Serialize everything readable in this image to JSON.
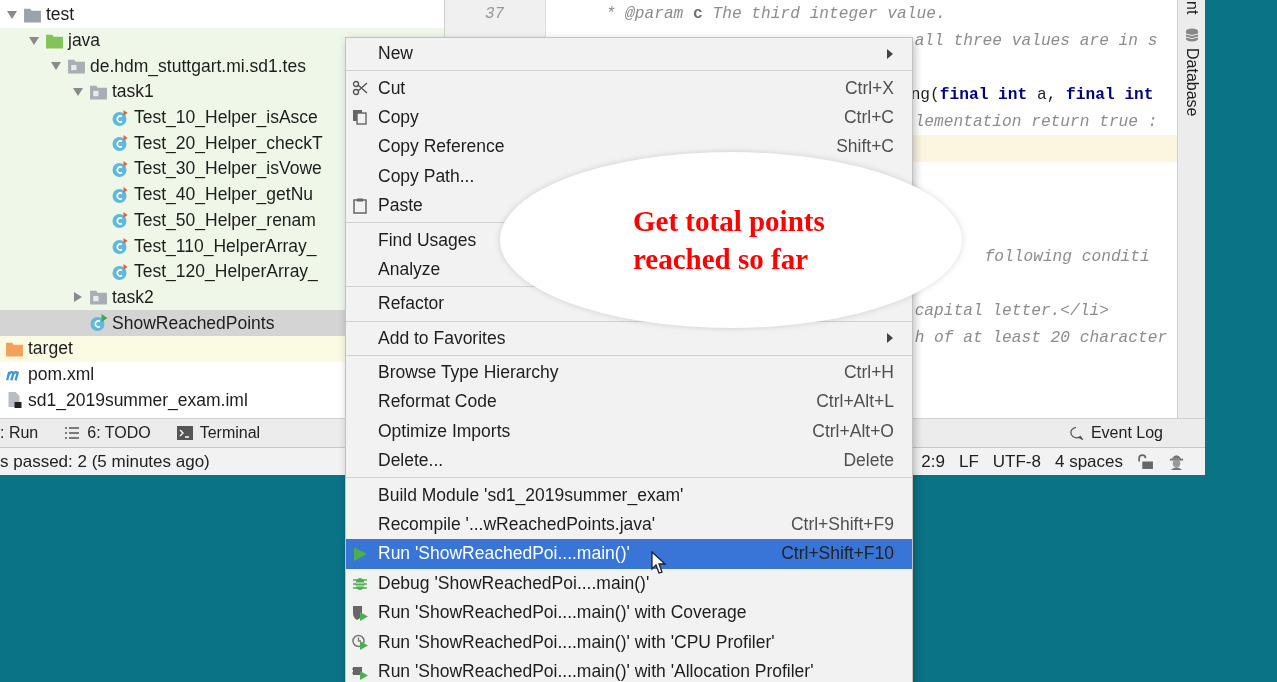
{
  "project_tree": [
    {
      "label": "test",
      "kind": "folder",
      "expanded": true,
      "selected": false,
      "children": [
        {
          "label": "java",
          "kind": "source-folder",
          "expanded": true,
          "selected": false,
          "children": [
            {
              "label": "de.hdm_stuttgart.mi.sd1.tes",
              "kind": "package",
              "expanded": true,
              "selected": false,
              "children": [
                {
                  "label": "task1",
                  "kind": "package",
                  "expanded": true,
                  "selected": false,
                  "children": [
                    {
                      "label": "Test_10_Helper_isAsce",
                      "kind": "test-class",
                      "selected": false
                    },
                    {
                      "label": "Test_20_Helper_checkT",
                      "kind": "test-class",
                      "selected": false
                    },
                    {
                      "label": "Test_30_Helper_isVowe",
                      "kind": "test-class",
                      "selected": false
                    },
                    {
                      "label": "Test_40_Helper_getNu",
                      "kind": "test-class",
                      "selected": false
                    },
                    {
                      "label": "Test_50_Helper_renam",
                      "kind": "test-class",
                      "selected": false
                    },
                    {
                      "label": "Test_110_HelperArray_",
                      "kind": "test-class",
                      "selected": false
                    },
                    {
                      "label": "Test_120_HelperArray_",
                      "kind": "test-class",
                      "selected": false
                    }
                  ]
                },
                {
                  "label": "task2",
                  "kind": "package",
                  "expanded": false,
                  "selected": false
                },
                {
                  "label": "ShowReachedPoints",
                  "kind": "runnable-class",
                  "selected": true
                }
              ]
            }
          ]
        }
      ]
    },
    {
      "label": "target",
      "kind": "excluded-folder",
      "selected": false
    },
    {
      "label": "pom.xml",
      "kind": "maven-file",
      "selected": false
    },
    {
      "label": "sd1_2019summer_exam.iml",
      "kind": "module-file",
      "selected": false
    }
  ],
  "editor": {
    "lines": [
      {
        "kind": "full",
        "number": "37",
        "text": "* @param **c** The third integer value."
      },
      {
        "kind": "tail",
        "text": "all three values are in s"
      },
      {
        "kind": "gap"
      },
      {
        "kind": "tail-code",
        "text": "ng(**final** **int** a, **final** **int**"
      },
      {
        "kind": "tail",
        "text": "lementation return true :"
      },
      {
        "kind": "caret"
      },
      {
        "kind": "gap"
      },
      {
        "kind": "gap"
      },
      {
        "kind": "gap"
      },
      {
        "kind": "deep",
        "text": "following conditi"
      },
      {
        "kind": "gap"
      },
      {
        "kind": "tail",
        "text": "capital letter.</li>"
      },
      {
        "kind": "tail",
        "text": "h of at least 20 character"
      }
    ]
  },
  "side_strip": {
    "tabs": [
      {
        "label": "nt",
        "kind": "ant"
      },
      {
        "label": "Database",
        "kind": "database"
      }
    ]
  },
  "tool_tabs": [
    {
      "label": ": Run",
      "kind": "run"
    },
    {
      "label": "6: TODO",
      "kind": "todo"
    },
    {
      "label": "Terminal",
      "kind": "terminal"
    }
  ],
  "event_log": {
    "label": "Event Log"
  },
  "status_bar": {
    "message": "s passed: 2 (5 minutes ago)",
    "items": [
      "2:9",
      "LF",
      "UTF-8",
      "4 spaces"
    ]
  },
  "context_menu": {
    "items": [
      {
        "kind": "item",
        "label": "New",
        "submenu": true,
        "selected": false
      },
      {
        "kind": "separator"
      },
      {
        "kind": "cut",
        "label": "Cut",
        "shortcut": "Ctrl+X",
        "selected": false
      },
      {
        "kind": "copy",
        "label": "Copy",
        "shortcut": "Ctrl+C",
        "selected": false
      },
      {
        "kind": "item",
        "label": "Copy Reference",
        "shortcut": "Shift+C",
        "selected": false
      },
      {
        "kind": "item",
        "label": "Copy Path...",
        "selected": false
      },
      {
        "kind": "paste",
        "label": "Paste",
        "selected": false
      },
      {
        "kind": "separator"
      },
      {
        "kind": "item",
        "label": "Find Usages",
        "selected": false
      },
      {
        "kind": "item",
        "label": "Analyze",
        "selected": false
      },
      {
        "kind": "separator"
      },
      {
        "kind": "item",
        "label": "Refactor",
        "selected": false
      },
      {
        "kind": "separator"
      },
      {
        "kind": "item",
        "label": "Add to Favorites",
        "submenu": true,
        "selected": false
      },
      {
        "kind": "separator"
      },
      {
        "kind": "item",
        "label": "Browse Type Hierarchy",
        "shortcut": "Ctrl+H",
        "selected": false
      },
      {
        "kind": "item",
        "label": "Reformat Code",
        "shortcut": "Ctrl+Alt+L",
        "selected": false
      },
      {
        "kind": "item",
        "label": "Optimize Imports",
        "shortcut": "Ctrl+Alt+O",
        "selected": false
      },
      {
        "kind": "item",
        "label": "Delete...",
        "shortcut": "Delete",
        "selected": false
      },
      {
        "kind": "separator"
      },
      {
        "kind": "item",
        "label": "Build Module 'sd1_2019summer_exam'",
        "selected": false
      },
      {
        "kind": "item",
        "label": "Recompile '...wReachedPoints.java'",
        "shortcut": "Ctrl+Shift+F9",
        "selected": false
      },
      {
        "kind": "run",
        "label": "Run 'ShowReachedPoi....main()'",
        "shortcut": "Ctrl+Shift+F10",
        "selected": true
      },
      {
        "kind": "debug",
        "label": "Debug 'ShowReachedPoi....main()'",
        "selected": false
      },
      {
        "kind": "coverage",
        "label": "Run 'ShowReachedPoi....main()' with Coverage",
        "selected": false
      },
      {
        "kind": "cpu-profiler",
        "label": "Run 'ShowReachedPoi....main()' with 'CPU Profiler'",
        "selected": false
      },
      {
        "kind": "allocation-profiler",
        "label": "Run 'ShowReachedPoi....main()' with 'Allocation Profiler'",
        "selected": false
      }
    ]
  },
  "callout": {
    "lines": [
      "Get total points",
      "reached so far"
    ]
  }
}
